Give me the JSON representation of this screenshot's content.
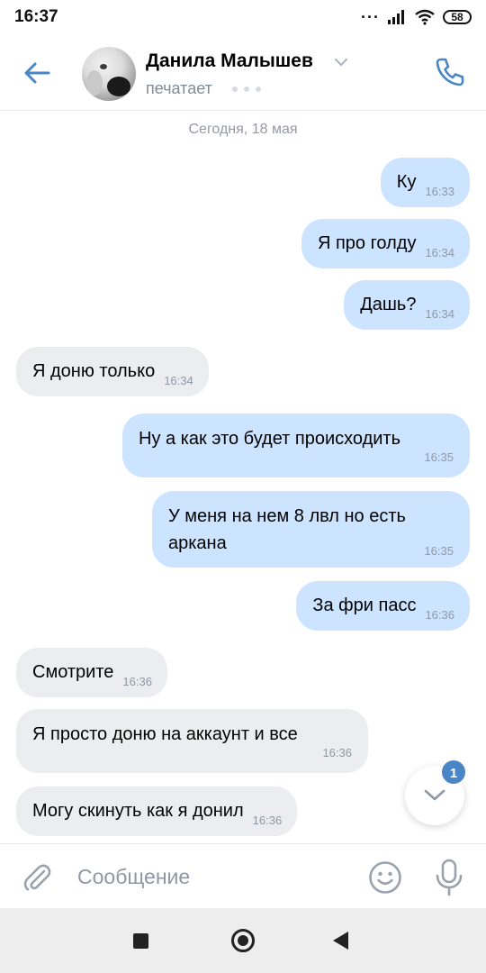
{
  "status_bar": {
    "time": "16:37",
    "battery": "58"
  },
  "header": {
    "contact_name": "Данила Малышев",
    "status": "печатает"
  },
  "date_separator": "Сегодня, 18 мая",
  "messages": [
    {
      "dir": "out",
      "text": "Ку",
      "time": "16:33"
    },
    {
      "dir": "out",
      "text": "Я про голду",
      "time": "16:34"
    },
    {
      "dir": "out",
      "text": "Дашь?",
      "time": "16:34"
    },
    {
      "dir": "in",
      "text": "Я доню только",
      "time": "16:34"
    },
    {
      "dir": "out",
      "text": "Ну а как это будет происходить",
      "time": "16:35"
    },
    {
      "dir": "out",
      "text": "У меня на нем 8 лвл но есть аркана",
      "time": "16:35"
    },
    {
      "dir": "out",
      "text": "За фри пасс",
      "time": "16:36"
    },
    {
      "dir": "in",
      "text": "Смотрите",
      "time": "16:36"
    },
    {
      "dir": "in",
      "text": "Я просто доню на аккаунт и все",
      "time": "16:36"
    },
    {
      "dir": "in",
      "text": "Могу скинуть как я донил",
      "time": "16:36"
    }
  ],
  "scroll_button": {
    "unread_count": "1"
  },
  "composer": {
    "placeholder": "Сообщение"
  },
  "colors": {
    "accent": "#4a86c5",
    "outgoing_bubble": "#cce4ff",
    "incoming_bubble": "#ebedf0"
  },
  "icons": [
    "back-arrow-icon",
    "phone-icon",
    "chevron-down-icon",
    "paperclip-icon",
    "smile-icon",
    "microphone-icon"
  ]
}
